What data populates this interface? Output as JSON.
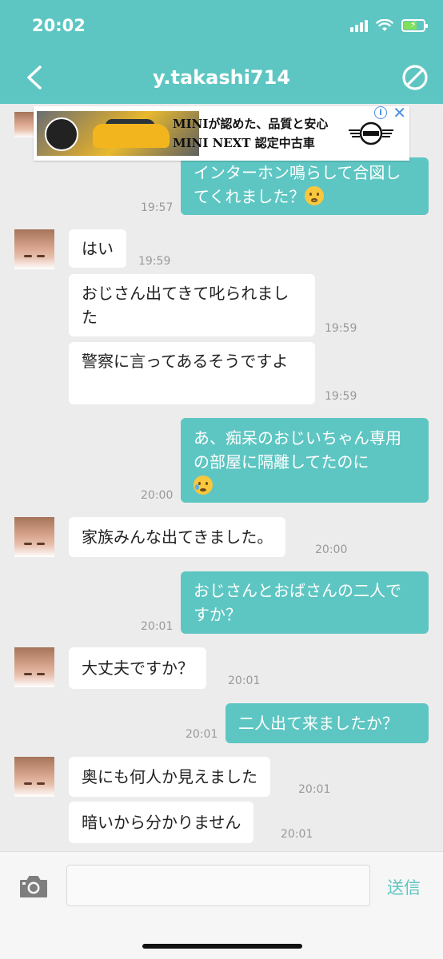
{
  "status_bar": {
    "time": "20:02"
  },
  "header": {
    "title": "y.takashi714",
    "back_icon": "chevron-left-icon",
    "block_icon": "block-icon",
    "color": "#5ec6c2"
  },
  "ad": {
    "line1": "MINIが認めた、品質と安心",
    "line2": "MINI NEXT 認定中古車",
    "info_label": "i",
    "close_label": "✕"
  },
  "messages": [
    {
      "side": "out",
      "text": "インターホン鳴らして合図してくれました？",
      "time": "19:57"
    },
    {
      "side": "in",
      "text": "はい",
      "time": "19:59"
    },
    {
      "side": "in",
      "text": "おじさん出てきて叱られました",
      "time": "19:59"
    },
    {
      "side": "in",
      "text": "警察に言ってあるそうですよ",
      "time": "19:59"
    },
    {
      "side": "out",
      "text": "あ、痴呆のおじいちゃん専用の部屋に隔離してたのに",
      "time": "20:00"
    },
    {
      "side": "in",
      "text": "家族みんな出てきました。",
      "time": "20:00"
    },
    {
      "side": "out",
      "text": "おじさんとおばさんの二人ですか？",
      "time": "20:01"
    },
    {
      "side": "in",
      "text": "大丈夫ですか？",
      "time": "20:01"
    },
    {
      "side": "out",
      "text": "二人出て来ましたか？",
      "time": "20:01"
    },
    {
      "side": "in",
      "text": "奥にも何人か見えました",
      "time": "20:01"
    },
    {
      "side": "in",
      "text": "暗いから分かりません",
      "time": "20:01"
    }
  ],
  "input_bar": {
    "camera_icon": "camera-icon",
    "placeholder": "",
    "send_label": "送信"
  }
}
